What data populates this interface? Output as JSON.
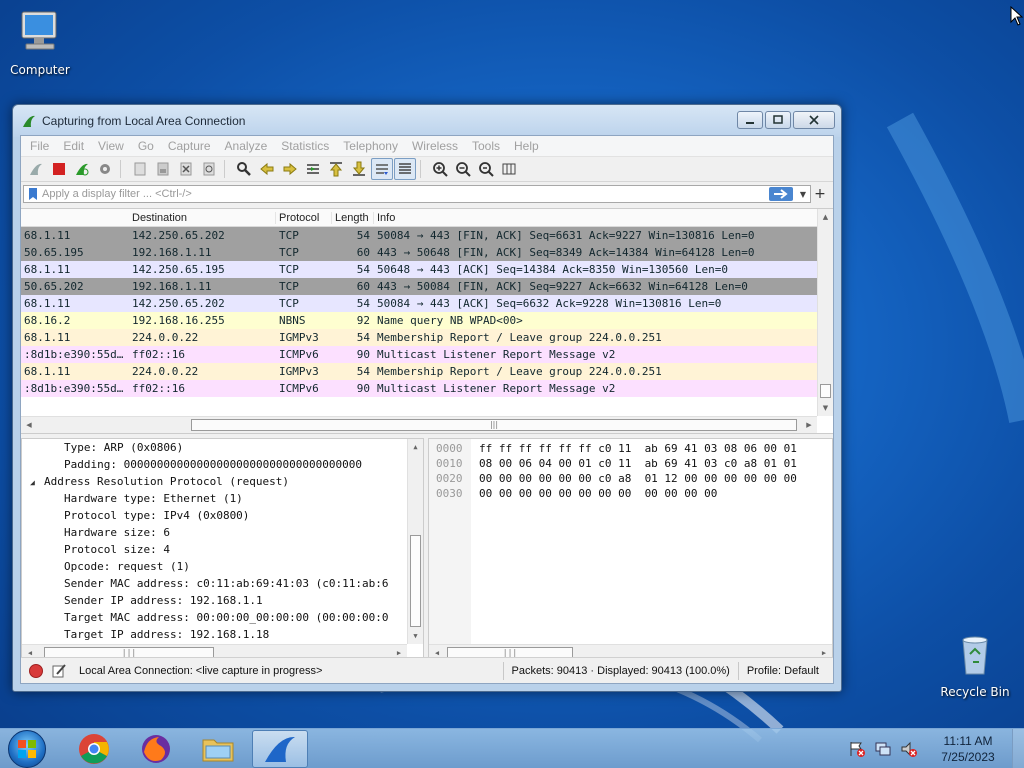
{
  "desktop": {
    "computer_label": "Computer",
    "recycle_label": "Recycle Bin"
  },
  "window": {
    "title": "Capturing from Local Area Connection"
  },
  "menu": [
    "File",
    "Edit",
    "View",
    "Go",
    "Capture",
    "Analyze",
    "Statistics",
    "Telephony",
    "Wireless",
    "Tools",
    "Help"
  ],
  "filter": {
    "placeholder": "Apply a display filter ... <Ctrl-/>"
  },
  "packet_list": {
    "columns": {
      "destination": "Destination",
      "protocol": "Protocol",
      "length": "Length",
      "info": "Info"
    },
    "rows": [
      {
        "src": "68.1.11",
        "dst": "142.250.65.202",
        "proto": "TCP",
        "len": "54",
        "info": "50084 → 443 [FIN, ACK] Seq=6631 Ack=9227 Win=130816 Len=0",
        "bg": "#a0a0a0"
      },
      {
        "src": "50.65.195",
        "dst": "192.168.1.11",
        "proto": "TCP",
        "len": "60",
        "info": "443 → 50648 [FIN, ACK] Seq=8349 Ack=14384 Win=64128 Len=0",
        "bg": "#a0a0a0"
      },
      {
        "src": "68.1.11",
        "dst": "142.250.65.195",
        "proto": "TCP",
        "len": "54",
        "info": "50648 → 443 [ACK] Seq=14384 Ack=8350 Win=130560 Len=0",
        "bg": "#e7e6ff"
      },
      {
        "src": "50.65.202",
        "dst": "192.168.1.11",
        "proto": "TCP",
        "len": "60",
        "info": "443 → 50084 [FIN, ACK] Seq=9227 Ack=6632 Win=64128 Len=0",
        "bg": "#a0a0a0"
      },
      {
        "src": "68.1.11",
        "dst": "142.250.65.202",
        "proto": "TCP",
        "len": "54",
        "info": "50084 → 443 [ACK] Seq=6632 Ack=9228 Win=130816 Len=0",
        "bg": "#e7e6ff"
      },
      {
        "src": "68.16.2",
        "dst": "192.168.16.255",
        "proto": "NBNS",
        "len": "92",
        "info": "Name query NB WPAD<00>",
        "bg": "#fefed0"
      },
      {
        "src": "68.1.11",
        "dst": "224.0.0.22",
        "proto": "IGMPv3",
        "len": "54",
        "info": "Membership Report / Leave group 224.0.0.251",
        "bg": "#fff3d6"
      },
      {
        "src": ":8d1b:e390:55d…",
        "dst": "ff02::16",
        "proto": "ICMPv6",
        "len": "90",
        "info": "Multicast Listener Report Message v2",
        "bg": "#fce0ff"
      },
      {
        "src": "68.1.11",
        "dst": "224.0.0.22",
        "proto": "IGMPv3",
        "len": "54",
        "info": "Membership Report / Leave group 224.0.0.251",
        "bg": "#fff3d6"
      },
      {
        "src": ":8d1b:e390:55d…",
        "dst": "ff02::16",
        "proto": "ICMPv6",
        "len": "90",
        "info": "Multicast Listener Report Message v2",
        "bg": "#fce0ff"
      }
    ]
  },
  "details": {
    "lines": [
      {
        "level": 1,
        "text": "Type: ARP (0x0806)"
      },
      {
        "level": 1,
        "text": "Padding: 000000000000000000000000000000000000"
      },
      {
        "level": 0,
        "text": "Address Resolution Protocol (request)",
        "expanded": true
      },
      {
        "level": 1,
        "text": "Hardware type: Ethernet (1)"
      },
      {
        "level": 1,
        "text": "Protocol type: IPv4 (0x0800)"
      },
      {
        "level": 1,
        "text": "Hardware size: 6"
      },
      {
        "level": 1,
        "text": "Protocol size: 4"
      },
      {
        "level": 1,
        "text": "Opcode: request (1)"
      },
      {
        "level": 1,
        "text": "Sender MAC address: c0:11:ab:69:41:03 (c0:11:ab:6"
      },
      {
        "level": 1,
        "text": "Sender IP address: 192.168.1.1"
      },
      {
        "level": 1,
        "text": "Target MAC address: 00:00:00_00:00:00 (00:00:00:0"
      },
      {
        "level": 1,
        "text": "Target IP address: 192.168.1.18"
      }
    ]
  },
  "bytes": {
    "offsets": [
      "0000",
      "0010",
      "0020",
      "0030"
    ],
    "hex": [
      "ff ff ff ff ff ff c0 11  ab 69 41 03 08 06 00 01",
      "08 00 06 04 00 01 c0 11  ab 69 41 03 c0 a8 01 01",
      "00 00 00 00 00 00 c0 a8  01 12 00 00 00 00 00 00",
      "00 00 00 00 00 00 00 00  00 00 00 00"
    ]
  },
  "status": {
    "capture_text": "Local Area Connection: <live capture in progress>",
    "packets_text": "Packets: 90413 · Displayed: 90413 (100.0%)",
    "profile_text": "Profile: Default"
  },
  "taskbar": {
    "time": "11:11 AM",
    "date": "7/25/2023"
  }
}
